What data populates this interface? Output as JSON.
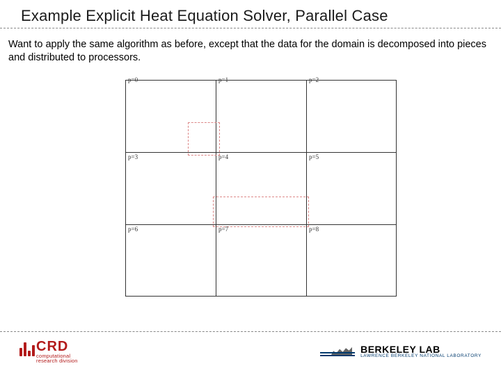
{
  "title": "Example Explicit Heat Equation Solver, Parallel Case",
  "body": "Want to apply the same algorithm as before, except that the data for the domain is decomposed into pieces and distributed to processors.",
  "diagram": {
    "cells": [
      {
        "label": "p=0",
        "row": 0,
        "col": 0
      },
      {
        "label": "p=1",
        "row": 0,
        "col": 1
      },
      {
        "label": "p=2",
        "row": 0,
        "col": 2
      },
      {
        "label": "p=3",
        "row": 1,
        "col": 0
      },
      {
        "label": "p=4",
        "row": 1,
        "col": 1
      },
      {
        "label": "p=5",
        "row": 1,
        "col": 2
      },
      {
        "label": "p=6",
        "row": 2,
        "col": 0
      },
      {
        "label": "p=7",
        "row": 2,
        "col": 1
      },
      {
        "label": "p=8",
        "row": 2,
        "col": 2
      }
    ]
  },
  "footer": {
    "left": {
      "main": "CRD",
      "sub1": "computational",
      "sub2": "research division"
    },
    "right": {
      "main": "BERKELEY LAB",
      "sub": "LAWRENCE BERKELEY NATIONAL LABORATORY"
    }
  }
}
